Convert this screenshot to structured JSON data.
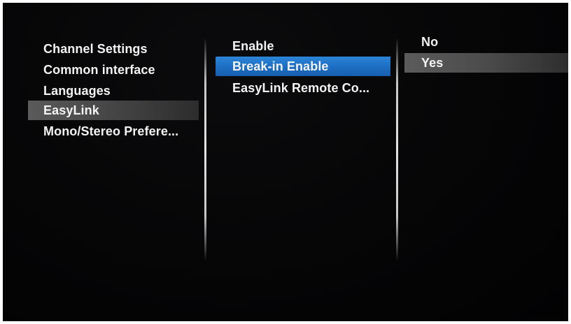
{
  "menu_columns": {
    "left": {
      "items": [
        {
          "label": "Channel Settings"
        },
        {
          "label": "Common interface"
        },
        {
          "label": "Languages"
        },
        {
          "label": "EasyLink"
        },
        {
          "label": "Mono/Stereo Prefere..."
        }
      ],
      "selected_label": "EasyLink"
    },
    "middle": {
      "items": [
        {
          "label": "Enable"
        },
        {
          "label": "Break-in Enable"
        },
        {
          "label": "EasyLink Remote Co..."
        }
      ],
      "focused_label": "Break-in Enable"
    },
    "right": {
      "items": [
        {
          "label": "No"
        },
        {
          "label": "Yes"
        }
      ],
      "current_value": "Yes"
    }
  },
  "colors": {
    "background": "#050506",
    "text": "#f3f3f3",
    "focus_highlight": "#1d6fc4",
    "selected_highlight": "#4a4a4a"
  }
}
